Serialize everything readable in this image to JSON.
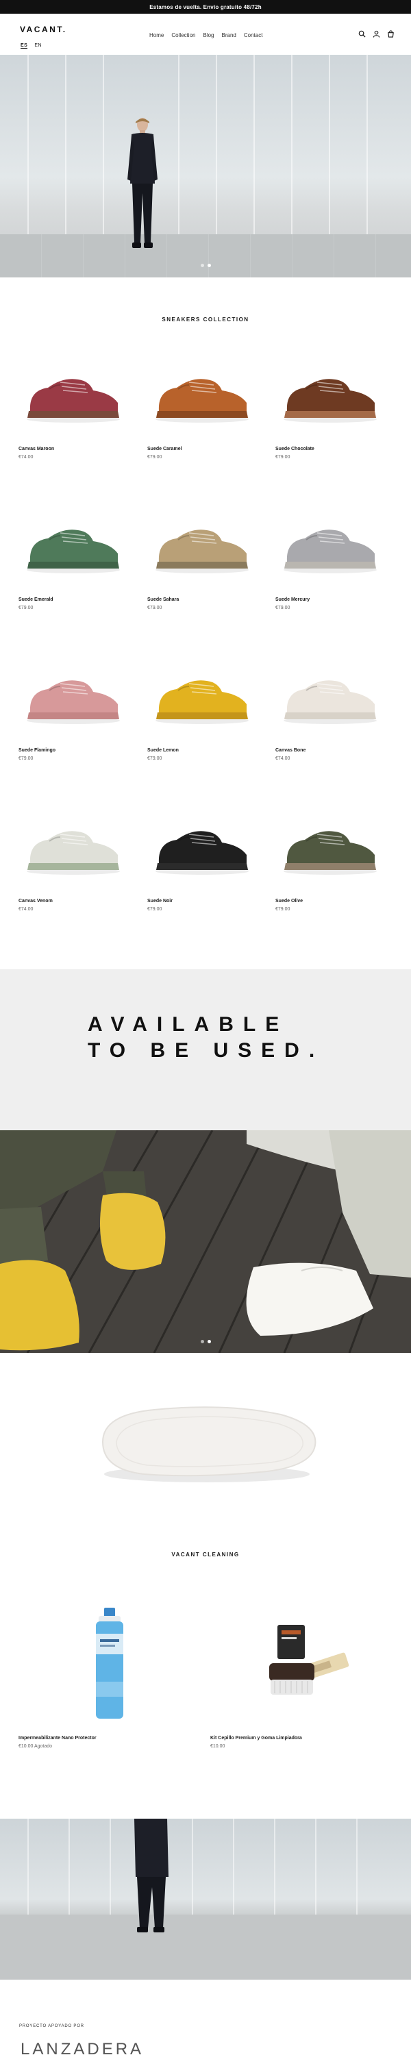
{
  "announcement": "Estamos de vuelta. Envío gratuito 48/72h",
  "header": {
    "logo": "VACANT.",
    "languages": [
      "ES",
      "EN"
    ],
    "active_language": "ES",
    "nav": [
      "Home",
      "Collection",
      "Blog",
      "Brand",
      "Contact"
    ]
  },
  "icons": [
    "search-icon",
    "account-icon",
    "cart-icon"
  ],
  "sneakers": {
    "title": "SNEAKERS COLLECTION",
    "products": [
      {
        "name": "Canvas Maroon",
        "price": "€74.00",
        "color": "#9a3a45",
        "sole": "#7a4a3c"
      },
      {
        "name": "Suede Caramel",
        "price": "€79.00",
        "color": "#b8622b",
        "sole": "#8c4a22"
      },
      {
        "name": "Suede Chocolate",
        "price": "€79.00",
        "color": "#6e3a22",
        "sole": "#a46a48"
      },
      {
        "name": "Suede Emerald",
        "price": "€79.00",
        "color": "#4f7a5a",
        "sole": "#3f6348"
      },
      {
        "name": "Suede Sahara",
        "price": "€79.00",
        "color": "#b9a077",
        "sole": "#8a7a5c"
      },
      {
        "name": "Suede Mercury",
        "price": "€79.00",
        "color": "#a9a9ad",
        "sole": "#b9b6b0"
      },
      {
        "name": "Suede Flamingo",
        "price": "€79.00",
        "color": "#d7999a",
        "sole": "#c48585"
      },
      {
        "name": "Suede Lemon",
        "price": "€79.00",
        "color": "#e2b21f",
        "sole": "#c4951a"
      },
      {
        "name": "Canvas Bone",
        "price": "€74.00",
        "color": "#ebe5dd",
        "sole": "#d8d2c8"
      },
      {
        "name": "Canvas Venom",
        "price": "€74.00",
        "color": "#dfe0d8",
        "sole": "#a6b59c"
      },
      {
        "name": "Suede Noir",
        "price": "€79.00",
        "color": "#1f1f1f",
        "sole": "#2b2b2b"
      },
      {
        "name": "Suede Olive",
        "price": "€79.00",
        "color": "#505840",
        "sole": "#8f7f6a"
      }
    ]
  },
  "banner": {
    "line1": "AVAILABLE",
    "line2": "TO BE USED."
  },
  "cleaning": {
    "title": "VACANT CLEANING",
    "products": [
      {
        "name": "Impermeabilizante Nano Protector",
        "price": "€10.00 Agotado"
      },
      {
        "name": "Kit Cepillo Premium y Goma Limpiadora",
        "price": "€10.00"
      }
    ]
  },
  "footer": {
    "supported_by": "PROYECTO APOYADO POR",
    "partner": "LANZADERA"
  },
  "colors": {
    "announcement_bg": "#111111",
    "banner_bg": "#efefef",
    "text": "#1a1a1a",
    "muted": "#666666"
  }
}
